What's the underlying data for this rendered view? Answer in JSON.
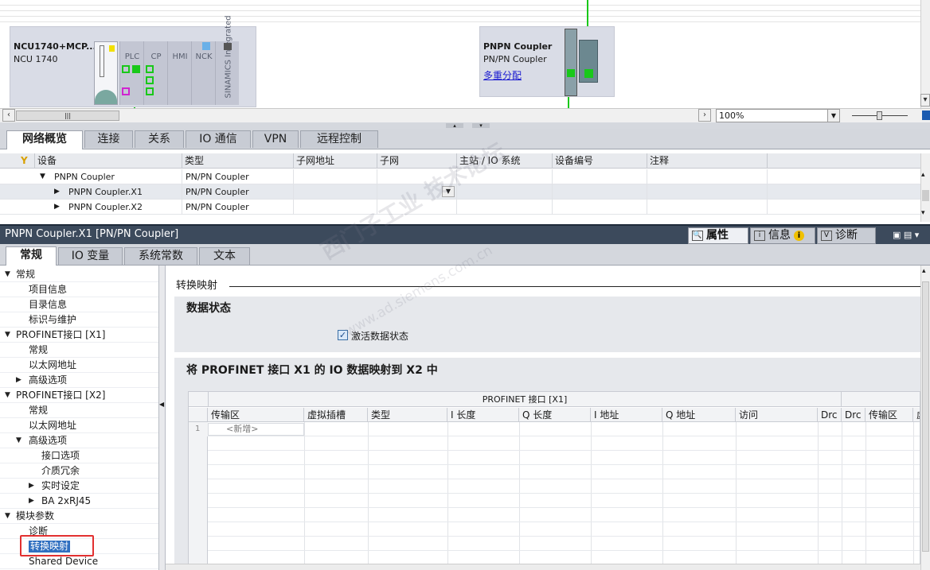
{
  "network_view": {
    "device1": {
      "title": "NCU1740+MCP...",
      "subtitle": "NCU 1740",
      "modules": [
        "PLC",
        "CP",
        "HMI",
        "NCK"
      ],
      "integrated_label": "SINAMICS Integrated"
    },
    "device2": {
      "title": "PNPN Coupler",
      "subtitle": "PN/PN Coupler",
      "link": "多重分配"
    },
    "zoom": "100%"
  },
  "main_tabs": [
    "网络概览",
    "连接",
    "关系",
    "IO 通信",
    "VPN",
    "远程控制"
  ],
  "overview": {
    "columns": [
      "设备",
      "类型",
      "子网地址",
      "子网",
      "主站 / IO 系统",
      "设备编号",
      "注释"
    ],
    "rows": [
      {
        "device": "PNPN Coupler",
        "type": "PN/PN Coupler"
      },
      {
        "device": "PNPN Coupler.X1",
        "type": "PN/PN Coupler"
      },
      {
        "device": "PNPN Coupler.X2",
        "type": "PN/PN Coupler"
      }
    ]
  },
  "inspector": {
    "title": "PNPN Coupler.X1 [PN/PN Coupler]",
    "tabs": {
      "properties": "属性",
      "info": "信息",
      "diagnostics": "诊断"
    },
    "sub_tabs": [
      "常规",
      "IO 变量",
      "系统常数",
      "文本"
    ]
  },
  "tree": [
    {
      "label": "常规",
      "level": 0,
      "arrow": "down"
    },
    {
      "label": "项目信息",
      "level": 1
    },
    {
      "label": "目录信息",
      "level": 1
    },
    {
      "label": "标识与维护",
      "level": 1
    },
    {
      "label": "PROFINET接口 [X1]",
      "level": 0,
      "arrow": "down"
    },
    {
      "label": "常规",
      "level": 1
    },
    {
      "label": "以太网地址",
      "level": 1
    },
    {
      "label": "高级选项",
      "level": 1,
      "arrow": "right"
    },
    {
      "label": "PROFINET接口 [X2]",
      "level": 0,
      "arrow": "down"
    },
    {
      "label": "常规",
      "level": 1
    },
    {
      "label": "以太网地址",
      "level": 1
    },
    {
      "label": "高级选项",
      "level": 1,
      "arrow": "down"
    },
    {
      "label": "接口选项",
      "level": 2
    },
    {
      "label": "介质冗余",
      "level": 2
    },
    {
      "label": "实时设定",
      "level": 2,
      "arrow": "right"
    },
    {
      "label": "BA 2xRJ45",
      "level": 2,
      "arrow": "right"
    },
    {
      "label": "模块参数",
      "level": 0,
      "arrow": "down"
    },
    {
      "label": "诊断",
      "level": 1
    },
    {
      "label": "转换映射",
      "level": 1,
      "selected": true
    },
    {
      "label": "Shared Device",
      "level": 1
    }
  ],
  "content": {
    "section_title": "转换映射",
    "data_status": {
      "title": "数据状态",
      "checkbox_label": "激活数据状态",
      "checked": true
    },
    "mapping": {
      "title": "将 PROFINET 接口 X1 的 IO 数据映射到 X2 中",
      "group_header": "PROFINET 接口 [X1]",
      "columns": [
        "传输区",
        "虚拟插槽",
        "类型",
        "I 长度",
        "Q 长度",
        "I 地址",
        "Q 地址",
        "访问",
        "Drc",
        "Drc",
        "传输区",
        "虚"
      ],
      "row_number": "1",
      "add_placeholder": "<新增>"
    }
  },
  "watermark": {
    "line1": "西门子工业 技术论坛",
    "line2": "www.ad.siemens.com.cn"
  },
  "colors": {
    "accent_green": "#19c819",
    "inspector_header": "#3c4a5c",
    "highlight_red": "#e23030",
    "link_blue": "#1a1ad0"
  }
}
